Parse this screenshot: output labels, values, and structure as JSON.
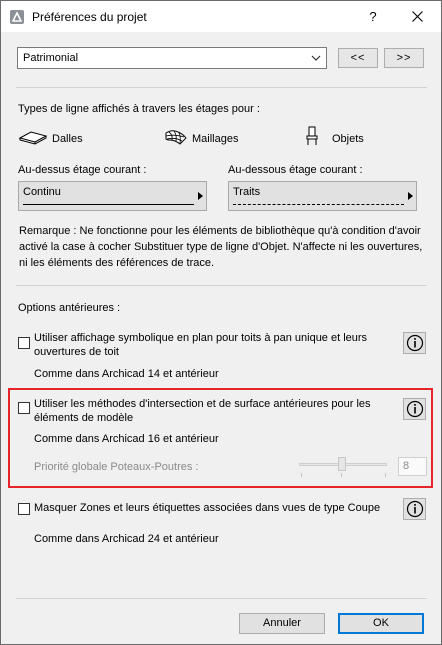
{
  "window": {
    "title": "Préférences du projet",
    "help_label": "?",
    "close_label": "✕"
  },
  "preset": {
    "selected": "Patrimonial",
    "prev_label": "<<",
    "next_label": ">>"
  },
  "line_types": {
    "heading": "Types de ligne affichés à travers les étages pour :",
    "items": [
      {
        "label": "Dalles",
        "icon": "slab-icon"
      },
      {
        "label": "Maillages",
        "icon": "mesh-icon"
      },
      {
        "label": "Objets",
        "icon": "chair-object-icon"
      }
    ],
    "above": {
      "label": "Au-dessus étage courant :",
      "value": "Continu"
    },
    "below": {
      "label": "Au-dessous étage courant :",
      "value": "Traits"
    }
  },
  "remark": "Remarque : Ne fonctionne pour les éléments de bibliothèque qu'à condition d'avoir activé la case à cocher Substituer type de ligne d'Objet. N'affecte ni les ouvertures, ni les éléments des références de trace.",
  "legacy": {
    "heading": "Options antérieures :",
    "options": [
      {
        "label": "Utiliser affichage symbolique en plan pour toits à pan unique et leurs ouvertures de toit",
        "checked": false,
        "note": "Comme dans Archicad 14 et antérieur"
      },
      {
        "label": "Utiliser les méthodes d'intersection et de surface antérieures pour les éléments de modèle",
        "checked": false,
        "note": "Comme dans Archicad 16 et antérieur",
        "sub_label": "Priorité globale Poteaux-Poutres :",
        "sub_value": "8"
      },
      {
        "label": "Masquer Zones et leurs étiquettes associées dans vues de type Coupe",
        "checked": false,
        "note": "Comme dans Archicad 24 et antérieur"
      }
    ]
  },
  "footer": {
    "cancel_label": "Annuler",
    "ok_label": "OK"
  },
  "colors": {
    "highlight": "#e8242b",
    "ok_border": "#0078d7"
  }
}
